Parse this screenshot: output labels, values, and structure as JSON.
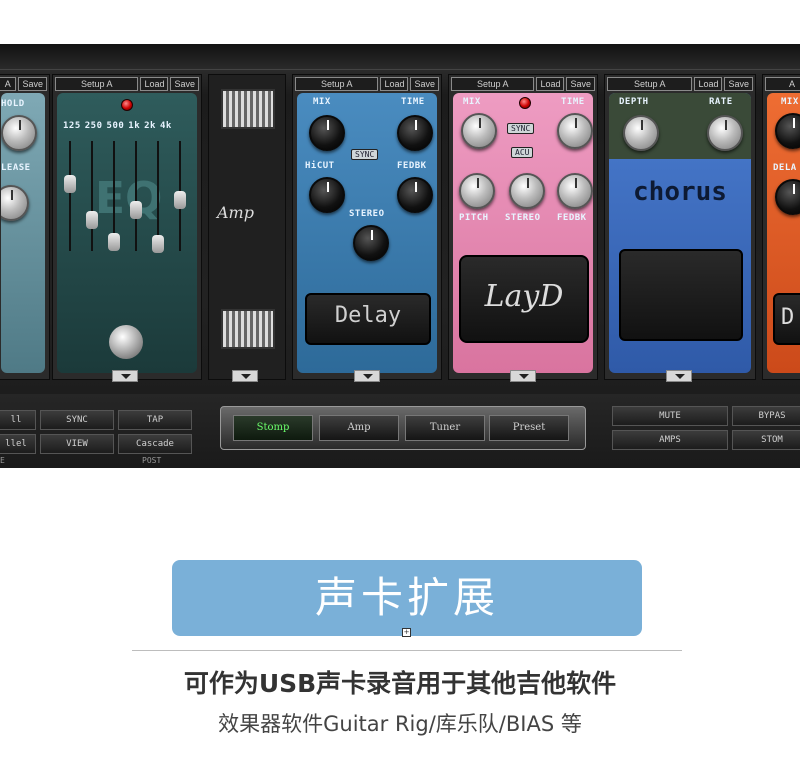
{
  "setup_bar": {
    "setup_label": "Setup A",
    "load_label": "Load",
    "save_label": "Save",
    "partial_name": "A",
    "partial_save": "Save"
  },
  "left_pedal": {
    "knob1": "HOLD",
    "knob2": "LEASE"
  },
  "eq_pedal": {
    "bands": [
      "125",
      "250",
      "500",
      "1k",
      "2k",
      "4k"
    ],
    "text": "EQ"
  },
  "amp_module": {
    "text": "Amp"
  },
  "delay_pedal": {
    "mix": "MIX",
    "time": "TIME",
    "hicut": "HiCUT",
    "sync": "SYNC",
    "fedbk": "FEDBK",
    "stereo": "STEREO",
    "name": "Delay",
    "color": "#3a78a8"
  },
  "layd_pedal": {
    "mix": "MIX",
    "time": "TIME",
    "sync": "SYNC",
    "acu": "ACU",
    "pitch": "PITCH",
    "stereo": "STEREO",
    "fedbk": "FEDBK",
    "name": "LayD",
    "color": "#e98fb8"
  },
  "chorus_pedal": {
    "depth": "DEPTH",
    "rate": "RATE",
    "name": "chorus",
    "color": "#3d6bbd"
  },
  "right_pedal": {
    "mix": "MIX",
    "delay": "DELA",
    "name": "D",
    "color": "#e0602a"
  },
  "bottom_left": {
    "row1": [
      "ll",
      "SYNC",
      "TAP"
    ],
    "row2": [
      "llel",
      "VIEW",
      "Cascade"
    ],
    "row3": [
      "E",
      "POST"
    ]
  },
  "nav": {
    "stomp": "Stomp",
    "amp": "Amp",
    "tuner": "Tuner",
    "preset": "Preset"
  },
  "bottom_right": {
    "row1": [
      "MUTE",
      "BYPAS"
    ],
    "row2": [
      "AMPS",
      "STOM"
    ]
  },
  "banner": {
    "title": "声卡扩展"
  },
  "subtitle": "可作为USB声卡录音用于其他吉他软件",
  "description": "效果器软件Guitar Rig/库乐队/BIAS 等"
}
